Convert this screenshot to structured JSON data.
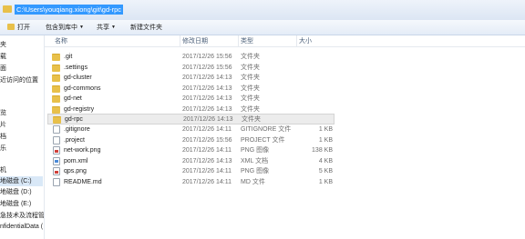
{
  "address": {
    "path": "C:\\Users\\youqiang.xiong\\git\\gd-rpc"
  },
  "toolbar": {
    "open_label": "打开",
    "include_label": "包含到库中",
    "share_label": "共享",
    "new_folder_label": "新建文件夹"
  },
  "sidebar": {
    "items": [
      {
        "label": "夹"
      },
      {
        "label": "载"
      },
      {
        "label": "面"
      },
      {
        "label": "近访问的位置"
      },
      {
        "label": "览"
      },
      {
        "label": "片"
      },
      {
        "label": "档"
      },
      {
        "label": "乐"
      },
      {
        "label": "机"
      },
      {
        "label": "地磁盘 (C:)"
      },
      {
        "label": "地磁盘 (D:)"
      },
      {
        "label": "地磁盘 (E:)"
      },
      {
        "label": "急技术及流程管理"
      },
      {
        "label": "nfidentialData ("
      }
    ]
  },
  "columns": {
    "name": "名称",
    "date": "修改日期",
    "type": "类型",
    "size": "大小"
  },
  "files": [
    {
      "name": ".git",
      "date": "2017/12/26 15:56",
      "type": "文件夹",
      "size": "",
      "icon": "folder"
    },
    {
      "name": ".settings",
      "date": "2017/12/26 15:56",
      "type": "文件夹",
      "size": "",
      "icon": "folder"
    },
    {
      "name": "gd-cluster",
      "date": "2017/12/26 14:13",
      "type": "文件夹",
      "size": "",
      "icon": "folder"
    },
    {
      "name": "gd-commons",
      "date": "2017/12/26 14:13",
      "type": "文件夹",
      "size": "",
      "icon": "folder"
    },
    {
      "name": "gd-net",
      "date": "2017/12/26 14:13",
      "type": "文件夹",
      "size": "",
      "icon": "folder"
    },
    {
      "name": "gd-registry",
      "date": "2017/12/26 14:13",
      "type": "文件夹",
      "size": "",
      "icon": "folder"
    },
    {
      "name": "gd-rpc",
      "date": "2017/12/26 14:13",
      "type": "文件夹",
      "size": "",
      "icon": "folder"
    },
    {
      "name": ".gitignore",
      "date": "2017/12/26 14:11",
      "type": "GITIGNORE 文件",
      "size": "1 KB",
      "icon": "file"
    },
    {
      "name": ".project",
      "date": "2017/12/26 15:56",
      "type": "PROJECT 文件",
      "size": "1 KB",
      "icon": "file"
    },
    {
      "name": "net-work.png",
      "date": "2017/12/26 14:11",
      "type": "PNG 图像",
      "size": "138 KB",
      "icon": "png"
    },
    {
      "name": "pom.xml",
      "date": "2017/12/26 14:13",
      "type": "XML 文档",
      "size": "4 KB",
      "icon": "xml"
    },
    {
      "name": "qps.png",
      "date": "2017/12/26 14:11",
      "type": "PNG 图像",
      "size": "5 KB",
      "icon": "png"
    },
    {
      "name": "README.md",
      "date": "2017/12/26 14:11",
      "type": "MD 文件",
      "size": "1 KB",
      "icon": "file"
    }
  ]
}
